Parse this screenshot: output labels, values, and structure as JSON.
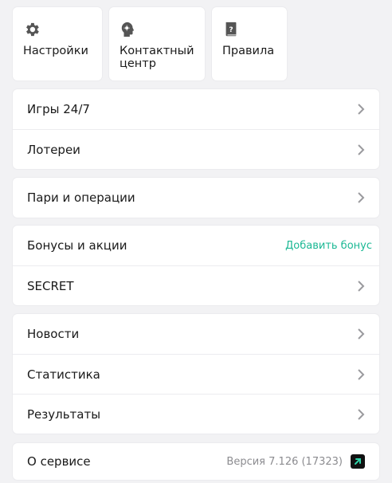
{
  "tiles": [
    {
      "label": "Настройки",
      "icon": "gear-icon"
    },
    {
      "label": "Контактный\nцентр",
      "icon": "support-head-icon"
    },
    {
      "label": "Правила",
      "icon": "rules-book-icon"
    }
  ],
  "groups": {
    "g1": [
      {
        "label": "Игры 24/7"
      },
      {
        "label": "Лотереи"
      }
    ],
    "g2": [
      {
        "label": "Пари и операции"
      }
    ],
    "g3": [
      {
        "label": "Бонусы и акции",
        "action": "Добавить бонус"
      },
      {
        "label": "SECRET"
      }
    ],
    "g4": [
      {
        "label": "Новости"
      },
      {
        "label": "Статистика"
      },
      {
        "label": "Результаты"
      }
    ]
  },
  "about": {
    "label": "О сервисе",
    "version": "Версия 7.126 (17323)"
  },
  "colors": {
    "accent": "#1bb894",
    "background": "#f2f2f4",
    "chevron": "#9a9a9e"
  }
}
